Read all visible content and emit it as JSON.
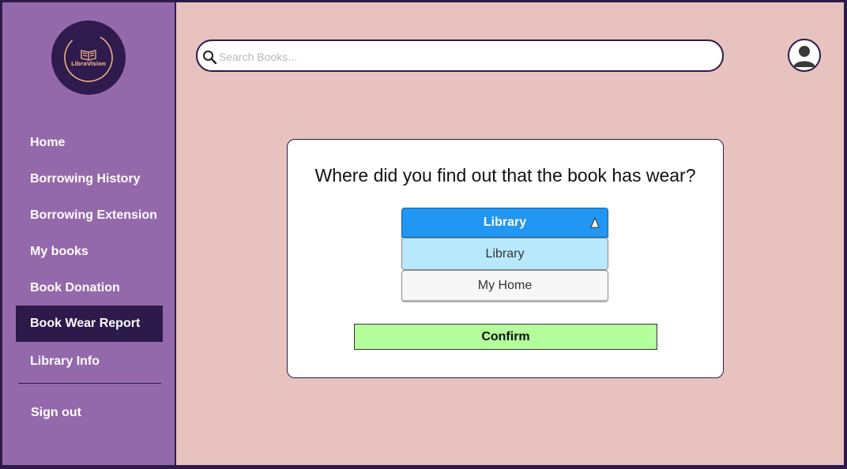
{
  "logo": {
    "text": "LibraVision"
  },
  "search": {
    "placeholder": "Search Books..."
  },
  "sidebar": {
    "items": [
      {
        "label": "Home"
      },
      {
        "label": "Borrowing History"
      },
      {
        "label": "Borrowing Extension"
      },
      {
        "label": "My books"
      },
      {
        "label": "Book Donation"
      },
      {
        "label": "Book Wear Report",
        "active": true
      },
      {
        "label": "Library Info"
      }
    ],
    "signout_label": "Sign out"
  },
  "dialog": {
    "question": "Where did you find out that the book has wear?",
    "select": {
      "selected": "Library",
      "options": [
        "Library",
        "My Home"
      ]
    },
    "confirm_label": "Confirm"
  },
  "colors": {
    "sidebar": "#9469ab",
    "active_nav": "#2c1a4b",
    "background": "#e8c2be",
    "select_head": "#2196f3",
    "option_highlight": "#b8e8fb",
    "confirm": "#b4fd9b"
  },
  "icons": {
    "search": "search-icon",
    "avatar": "user-avatar-icon",
    "caret": "caret-up-icon",
    "logo": "book-icon"
  }
}
